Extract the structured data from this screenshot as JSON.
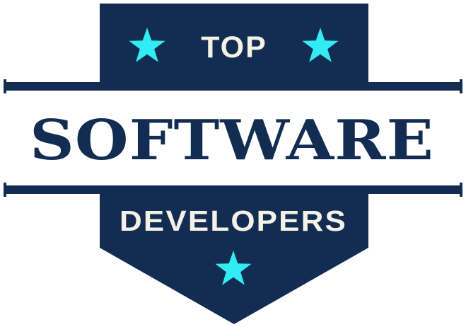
{
  "badge": {
    "top_text": "TOP",
    "main_text": "SOFTWARE",
    "bottom_text": "DEVELOPERS"
  },
  "colors": {
    "navy": "#132c52",
    "star": "#31ecf2",
    "light_text": "#f4f1e6",
    "background": "#ffffff"
  },
  "icons": [
    "star-icon",
    "star-icon",
    "star-icon"
  ]
}
